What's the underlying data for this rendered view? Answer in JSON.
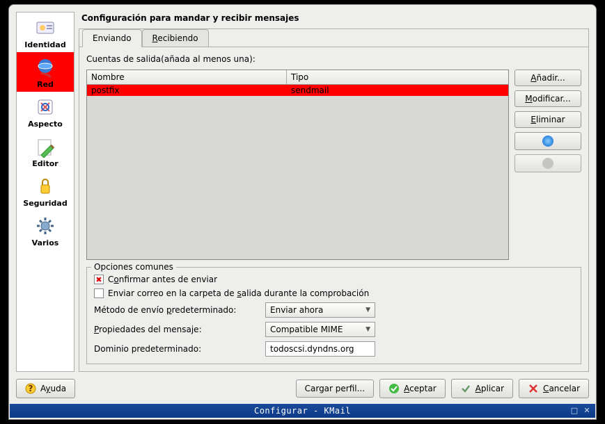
{
  "titlebar": {
    "text": "Configurar - KMail"
  },
  "sidebar": {
    "items": [
      {
        "label": "Identidad"
      },
      {
        "label": "Red"
      },
      {
        "label": "Aspecto"
      },
      {
        "label": "Editor"
      },
      {
        "label": "Seguridad"
      },
      {
        "label": "Varios"
      }
    ],
    "selected_index": 1
  },
  "page": {
    "title": "Configuración para mandar y recibir mensajes"
  },
  "tabs": {
    "items": [
      {
        "label": "Enviando"
      },
      {
        "label": "Recibiendo"
      }
    ],
    "active_index": 0
  },
  "outgoing": {
    "header_label": "Cuentas de salida(añada al menos una):",
    "columns": {
      "name": "Nombre",
      "type": "Tipo"
    },
    "rows": [
      {
        "name": "postfix",
        "type": "sendmail",
        "selected": true
      }
    ],
    "buttons": {
      "add": "Añadir...",
      "modify": "Modificar...",
      "remove": "Eliminar"
    }
  },
  "common": {
    "legend": "Opciones comunes",
    "confirm_before_send": {
      "label": "Confirmar antes de enviar",
      "checked": true
    },
    "send_in_outbox": {
      "label": "Enviar correo en la carpeta de salida durante la comprobación",
      "checked": false
    },
    "default_method": {
      "label": "Método de envío predeterminado:",
      "value": "Enviar ahora"
    },
    "message_props": {
      "label": "Propiedades del mensaje:",
      "value": "Compatible MIME"
    },
    "default_domain": {
      "label": "Dominio predeterminado:",
      "value": "todoscsi.dyndns.org"
    }
  },
  "dialog_buttons": {
    "help": "Ayuda",
    "load_profile": "Cargar perfil...",
    "ok": "Aceptar",
    "apply": "Aplicar",
    "cancel": "Cancelar"
  }
}
